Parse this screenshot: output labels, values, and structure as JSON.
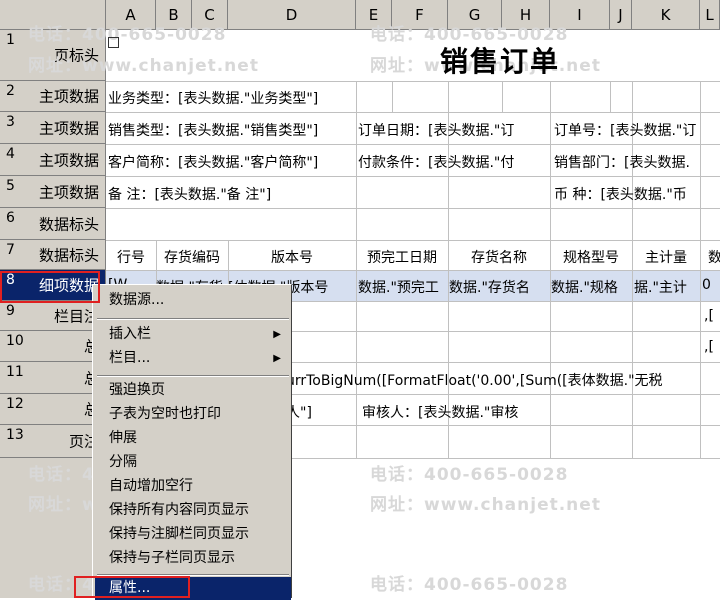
{
  "columns": [
    "A",
    "B",
    "C",
    "D",
    "E",
    "F",
    "G",
    "H",
    "I",
    "J",
    "K",
    "L"
  ],
  "rows": [
    {
      "num": "1",
      "label": "页标头"
    },
    {
      "num": "2",
      "label": "主项数据"
    },
    {
      "num": "3",
      "label": "主项数据"
    },
    {
      "num": "4",
      "label": "主项数据"
    },
    {
      "num": "5",
      "label": "主项数据"
    },
    {
      "num": "6",
      "label": "数据标头"
    },
    {
      "num": "7",
      "label": "数据标头"
    },
    {
      "num": "8",
      "label": "细项数据"
    },
    {
      "num": "9",
      "label": "栏目注"
    },
    {
      "num": "10",
      "label": "总"
    },
    {
      "num": "11",
      "label": "总"
    },
    {
      "num": "12",
      "label": "总"
    },
    {
      "num": "13",
      "label": "页注"
    }
  ],
  "title": "销售订单",
  "cells": {
    "r2_a": "业务类型：[表头数据.\"业务类型\"]",
    "r3_a": "销售类型：[表头数据.\"销售类型\"]",
    "r3_e": "订单日期：[表头数据.\"订",
    "r3_i": "订单号：[表头数据.\"订",
    "r4_a": "客户简称：[表头数据.\"客户简称\"]",
    "r4_e": "付款条件：[表头数据.\"付",
    "r4_i": "销售部门：[表头数据.",
    "r5_a": "备    注：[表头数据.\"备    注\"]",
    "r5_i": "币  种：[表头数据.\"币",
    "r7": [
      "行号",
      "存货编码",
      "版本号",
      "预完工日期",
      "存货名称",
      "规格型号",
      "主计量",
      "数"
    ],
    "r8": [
      "[W..",
      "数据.\"存货",
      "[体数据.\"版本号",
      "数据.\"预完工",
      "数据.\"存货名",
      "数据.\"规格",
      "据.\"主计",
      "0"
    ],
    "r9_l": ",[",
    "r10_l": ",[",
    "r11": "urrToBigNum([FormatFloat('0.00',[Sum([表体数据.\"无税",
    "r12_a": "人\"]",
    "r12_b": "审核人：[表头数据.\"审核"
  },
  "watermark": {
    "phone": "电话：400-665-0028",
    "site": "网址：www.chanjet.net"
  },
  "context_menu": {
    "items": [
      {
        "label": "数据源...",
        "submenu": false
      },
      {
        "label": "插入栏",
        "submenu": true
      },
      {
        "label": "栏目...",
        "submenu": true
      },
      {
        "label": "强迫换页",
        "submenu": false
      },
      {
        "label": "子表为空时也打印",
        "submenu": false
      },
      {
        "label": "伸展",
        "submenu": false
      },
      {
        "label": "分隔",
        "submenu": false
      },
      {
        "label": "自动增加空行",
        "submenu": false
      },
      {
        "label": "保持所有内容同页显示",
        "submenu": false
      },
      {
        "label": "保持与注脚栏同页显示",
        "submenu": false
      },
      {
        "label": "保持与子栏同页显示",
        "submenu": false
      },
      {
        "label": "属性...",
        "submenu": false
      }
    ]
  },
  "colors": {
    "highlight": "#0a246a",
    "annotation": "#e02020",
    "header_bg": "#d4d0c8"
  }
}
